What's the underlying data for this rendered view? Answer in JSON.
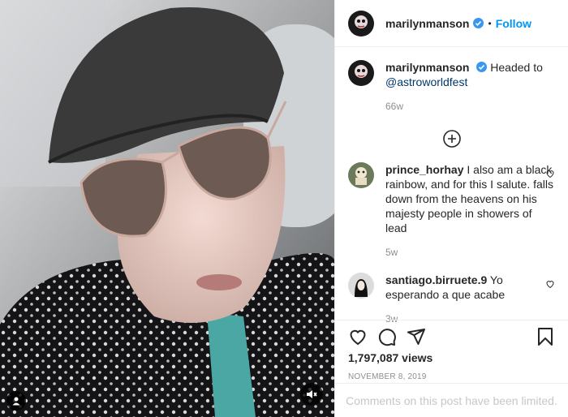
{
  "post": {
    "username": "marilynmanson",
    "follow_label": "Follow",
    "separator": "•",
    "caption_text": "Headed to",
    "caption_mention": "@astroworldfest",
    "caption_age": "66w",
    "views": "1,797,087 views",
    "date": "NOVEMBER 8, 2019",
    "comments_limited": "Comments on this post have been limited."
  },
  "comments": [
    {
      "user": "prince_horhay",
      "text": "I also am a black rainbow, and for this I salute. falls down from the heavens on his majesty people in showers of lead",
      "age": "5w"
    },
    {
      "user": "santiago.birruete.9",
      "text": "Yo esperando a que acabe",
      "age": "3w"
    }
  ],
  "icons": {
    "verified": "verified-badge-icon",
    "load_more": "plus-circle-icon",
    "like": "heart-icon",
    "comment": "comment-icon",
    "share": "paper-plane-icon",
    "save": "bookmark-icon",
    "mute": "muted-speaker-icon",
    "tags": "user-tag-icon"
  },
  "colors": {
    "accent": "#0095f6",
    "verified": "#3897f0",
    "muted": "#8e8e8e"
  }
}
